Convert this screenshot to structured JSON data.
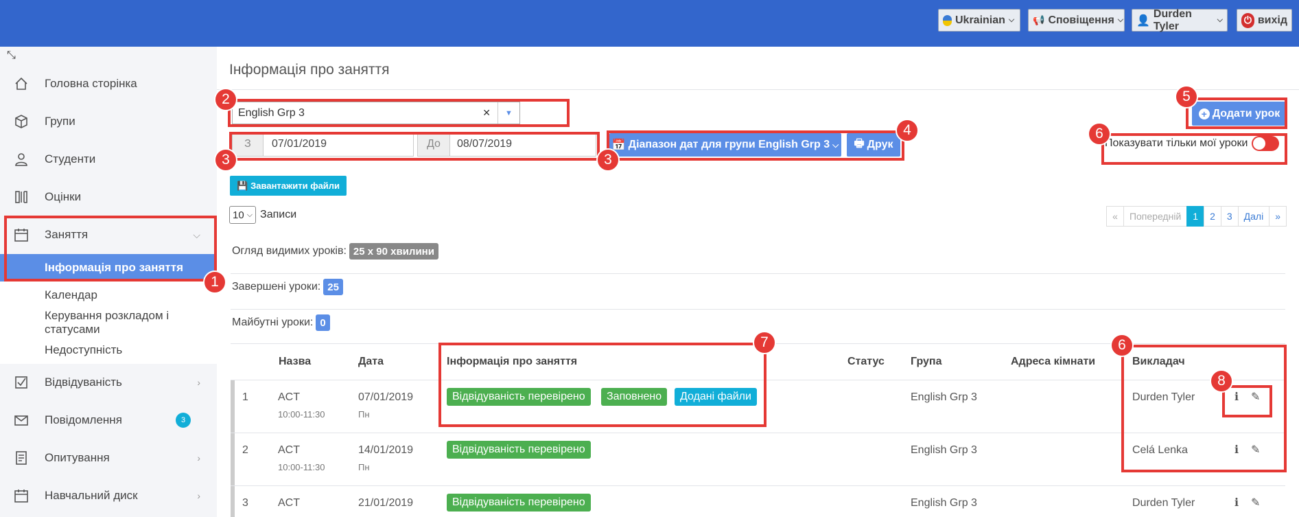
{
  "topbar": {
    "language": "Ukrainian",
    "notifications": "Сповіщення",
    "user": "Durden Tyler",
    "logout": "вихід"
  },
  "sidebar": {
    "items": [
      {
        "label": "Головна сторінка",
        "icon": "home-icon"
      },
      {
        "label": "Групи",
        "icon": "box-icon"
      },
      {
        "label": "Студенти",
        "icon": "user-icon"
      },
      {
        "label": "Оцінки",
        "icon": "grades-icon"
      },
      {
        "label": "Заняття",
        "icon": "calendar-icon"
      },
      {
        "label": "Відвідуваність",
        "icon": "checkbox-icon"
      },
      {
        "label": "Повідомлення",
        "icon": "envelope-icon",
        "badge": "3"
      },
      {
        "label": "Опитування",
        "icon": "survey-icon"
      },
      {
        "label": "Навчальний диск",
        "icon": "calendar-icon"
      }
    ],
    "subitems": [
      "Інформація про заняття",
      "Календар",
      "Керування розкладом і статусами",
      "Недоступність"
    ]
  },
  "main": {
    "title": "Інформація про заняття",
    "group_select": "English Grp 3",
    "date_from_label": "З",
    "date_from": "07/01/2019",
    "date_to_label": "До",
    "date_to": "08/07/2019",
    "range_button": "Діапазон дат для групи English Grp 3",
    "print_button": "Друк",
    "upload_button": "Завантажити файли",
    "add_lesson_button": "Додати урок",
    "only_mine_label": "Показувати тільки мої уроки",
    "page_length": "10",
    "records_label": "Записи",
    "pager": {
      "first": "«",
      "prev": "Попередній",
      "pages": [
        "1",
        "2",
        "3"
      ],
      "next": "Далі",
      "last": "»"
    },
    "overview_label": "Огляд видимих уроків:",
    "overview_value": "25 x 90 хвилини",
    "completed_label": "Завершені уроки:",
    "completed_value": "25",
    "future_label": "Майбутні уроки:",
    "future_value": "0"
  },
  "table": {
    "headers": [
      "Назва",
      "Дата",
      "Інформація про заняття",
      "Статус",
      "Група",
      "Адреса кімнати",
      "Викладач"
    ],
    "rows": [
      {
        "n": "1",
        "name": "ACT",
        "time": "10:00-11:30",
        "date": "07/01/2019",
        "day": "Пн",
        "labels": [
          "Відвідуваність перевірено",
          "Заповнено",
          "Додані файли"
        ],
        "group": "English Grp 3",
        "teacher": "Durden Tyler"
      },
      {
        "n": "2",
        "name": "ACT",
        "time": "10:00-11:30",
        "date": "14/01/2019",
        "day": "Пн",
        "labels": [
          "Відвідуваність перевірено"
        ],
        "group": "English Grp 3",
        "teacher": "Celá Lenka"
      },
      {
        "n": "3",
        "name": "ACT",
        "time": "",
        "date": "21/01/2019",
        "day": "",
        "labels": [
          "Відвідуваність перевірено"
        ],
        "group": "English Grp 3",
        "teacher": "Durden Tyler"
      }
    ]
  },
  "callouts": [
    "1",
    "2",
    "3",
    "3",
    "4",
    "5",
    "6",
    "6",
    "7",
    "8"
  ],
  "colors": {
    "topbar": "#3366cc",
    "accent": "#5b8ee6",
    "highlight": "#e53935",
    "success": "#4caf50",
    "info": "#11aed8"
  }
}
